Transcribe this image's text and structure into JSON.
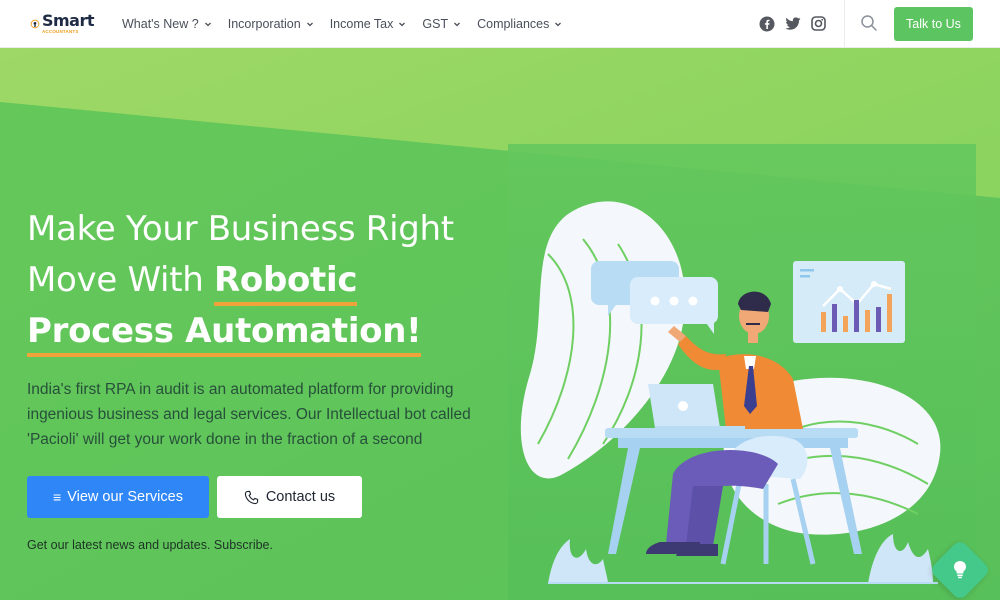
{
  "header": {
    "logo_word": "Smart",
    "logo_sub": "ACCOUNTANTS",
    "nav": [
      {
        "label": "What's New ?"
      },
      {
        "label": "Incorporation"
      },
      {
        "label": "Income Tax"
      },
      {
        "label": "GST"
      },
      {
        "label": "Compliances"
      }
    ],
    "socials": [
      "facebook-icon",
      "twitter-icon",
      "instagram-icon"
    ],
    "cta_label": "Talk to Us"
  },
  "hero": {
    "headline_line1": "Make Your Business Right",
    "headline_line2_plain": "Move With ",
    "headline_line2_bold": "Robotic",
    "headline_line3_bold": "Process Automation!",
    "description": "India's first RPA in audit is an automated platform for providing ingenious business and legal services. Our Intellectual bot called 'Pacioli' will get your work done in the fraction of a second",
    "primary_button": "View our Services",
    "secondary_button": "Contact us",
    "subscribe_text": "Get our latest news and updates. Subscribe."
  },
  "colors": {
    "accent_green": "#5cc562",
    "primary_blue": "#2f86f6",
    "underline_orange": "#f0a33b"
  }
}
